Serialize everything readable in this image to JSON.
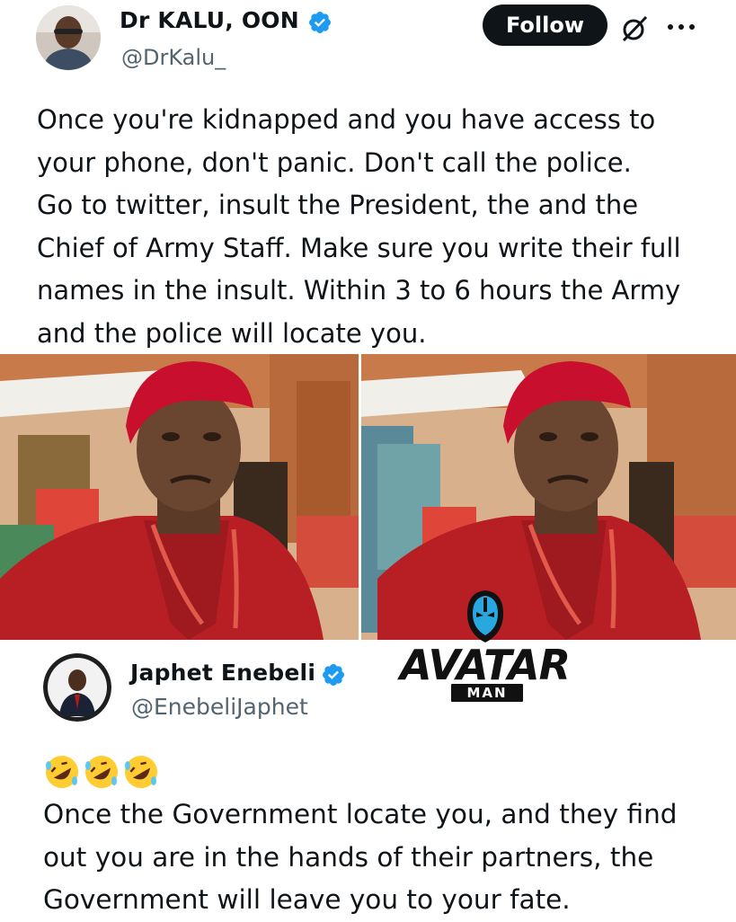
{
  "colors": {
    "text": "#0f1419",
    "handle": "#536471",
    "verified": "#1d9bf0",
    "follow_bg": "#0f1419",
    "cap_red": "#c8102e",
    "robe_red": "#b81f25"
  },
  "tweet": {
    "author": {
      "name": "Dr KALU, OON",
      "handle": "@DrKalu_",
      "verified": true
    },
    "follow_label": "Follow",
    "text": "Once you're kidnapped and you have access to\nyour phone, don't panic. Don't call the police.\nGo to twitter, insult the President, the and the\nChief of Army Staff. Make sure you write their full\nnames in the insult. Within 3 to 6 hours the Army\nand the police will locate you.",
    "icons": [
      "grok-icon",
      "more-icon"
    ]
  },
  "reply": {
    "author": {
      "name": "Japhet Enebeli",
      "handle": "@EnebeliJaphet",
      "verified": true
    },
    "emoji": [
      "rolling-on-floor-laughing",
      "rolling-on-floor-laughing",
      "rolling-on-floor-laughing"
    ],
    "text": "Once the Government locate you, and they find\nout you are in the hands of their partners, the\nGovernment will leave you to your fate."
  },
  "watermark": {
    "title": "AVATAR",
    "subtitle": "MAN"
  }
}
